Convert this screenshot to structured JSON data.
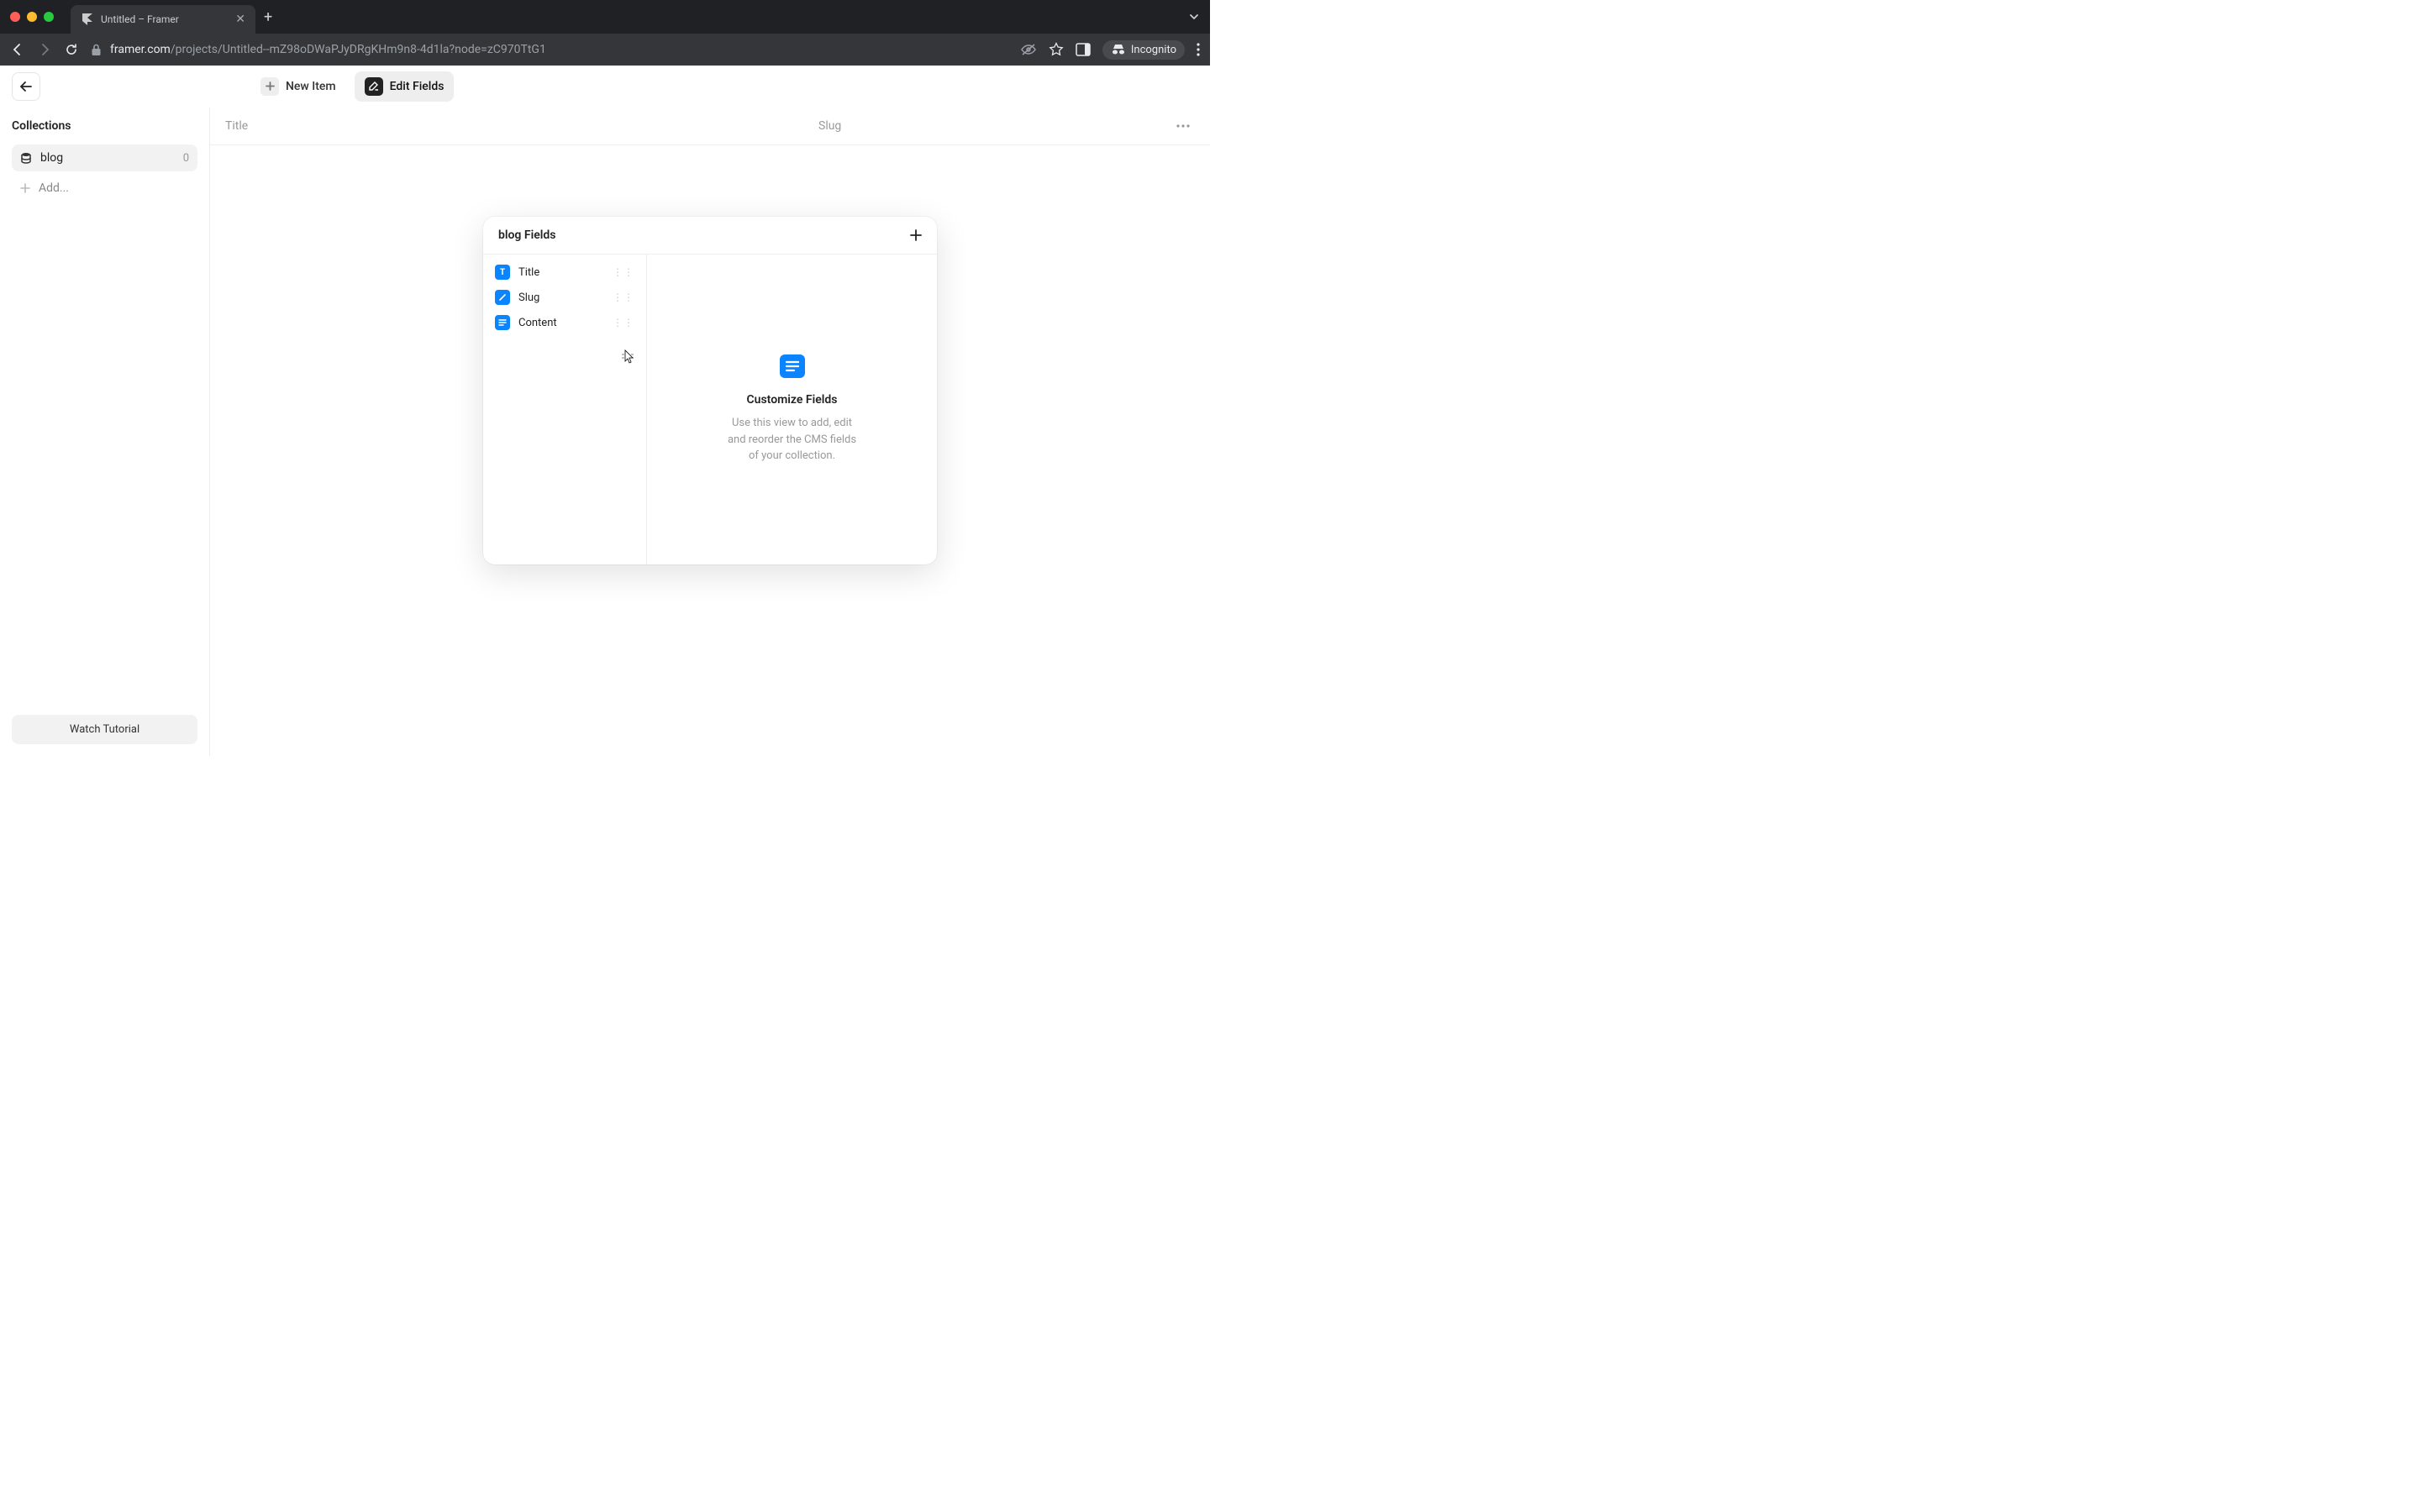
{
  "browser": {
    "tab_title": "Untitled – Framer",
    "url_domain": "framer.com",
    "url_path": "/projects/Untitled--mZ98oDWaPJyDRgKHm9n8-4d1la?node=zC970TtG1",
    "incognito_label": "Incognito"
  },
  "toolbar": {
    "new_item_label": "New Item",
    "edit_fields_label": "Edit Fields"
  },
  "sidebar": {
    "title": "Collections",
    "items": [
      {
        "name": "blog",
        "count": "0"
      }
    ],
    "add_label": "Add...",
    "tutorial_label": "Watch Tutorial"
  },
  "columns": {
    "title": "Title",
    "slug": "Slug"
  },
  "modal": {
    "title": "blog Fields",
    "fields": [
      {
        "name": "Title",
        "type": "text"
      },
      {
        "name": "Slug",
        "type": "link"
      },
      {
        "name": "Content",
        "type": "content"
      }
    ],
    "detail": {
      "heading": "Customize Fields",
      "text": "Use this view to add, edit and reorder the CMS fields of your collection."
    }
  }
}
